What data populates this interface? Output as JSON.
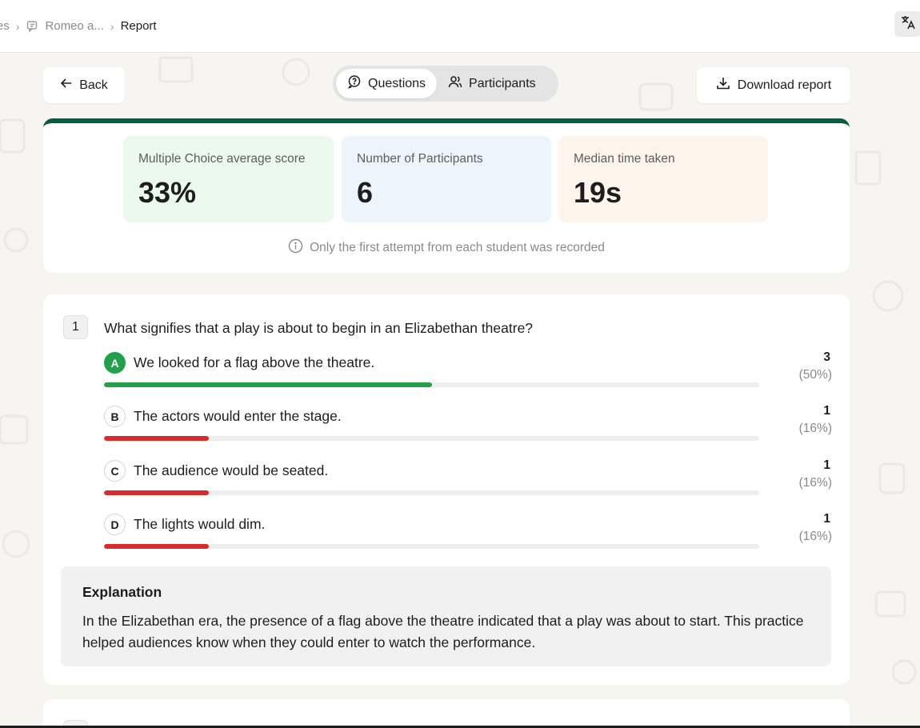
{
  "breadcrumb": {
    "items": [
      "es",
      "Romeo a...",
      "Report"
    ]
  },
  "toolbar": {
    "back_label": "Back",
    "tabs": [
      {
        "label": "Questions",
        "active": true
      },
      {
        "label": "Participants",
        "active": false
      }
    ],
    "download_label": "Download report"
  },
  "summary": {
    "stats": [
      {
        "label": "Multiple Choice average score",
        "value": "33%",
        "color": "#ecf9ef"
      },
      {
        "label": "Number of Participants",
        "value": "6",
        "color": "#edf5fc"
      },
      {
        "label": "Median time taken",
        "value": "19s",
        "color": "#fdf4ec"
      }
    ],
    "note": "Only the first attempt from each student was recorded",
    "accent": "#0c5a3f"
  },
  "question": {
    "number": "1",
    "text": "What signifies that a play is about to begin in an Elizabethan theatre?",
    "options": [
      {
        "letter": "A",
        "text": "We looked for a flag above the theatre.",
        "count": "3",
        "pct": "(50%)",
        "share": 0.5,
        "correct": true,
        "color": "#22a14a"
      },
      {
        "letter": "B",
        "text": "The actors would enter the stage.",
        "count": "1",
        "pct": "(16%)",
        "share": 0.16,
        "correct": false,
        "color": "#d92b2b"
      },
      {
        "letter": "C",
        "text": "The audience would be seated.",
        "count": "1",
        "pct": "(16%)",
        "share": 0.16,
        "correct": false,
        "color": "#d92b2b"
      },
      {
        "letter": "D",
        "text": "The lights would dim.",
        "count": "1",
        "pct": "(16%)",
        "share": 0.16,
        "correct": false,
        "color": "#d92b2b"
      }
    ],
    "explanation_title": "Explanation",
    "explanation": "In the Elizabethan era, the presence of a flag above the theatre indicated that a play was about to start. This practice helped audiences know when they could enter to watch the performance."
  },
  "icons": {
    "back": "arrow-left-icon",
    "questions": "chat-bubble-icon",
    "participants": "users-icon",
    "download": "download-icon",
    "translate": "translate-icon",
    "info": "info-icon"
  }
}
